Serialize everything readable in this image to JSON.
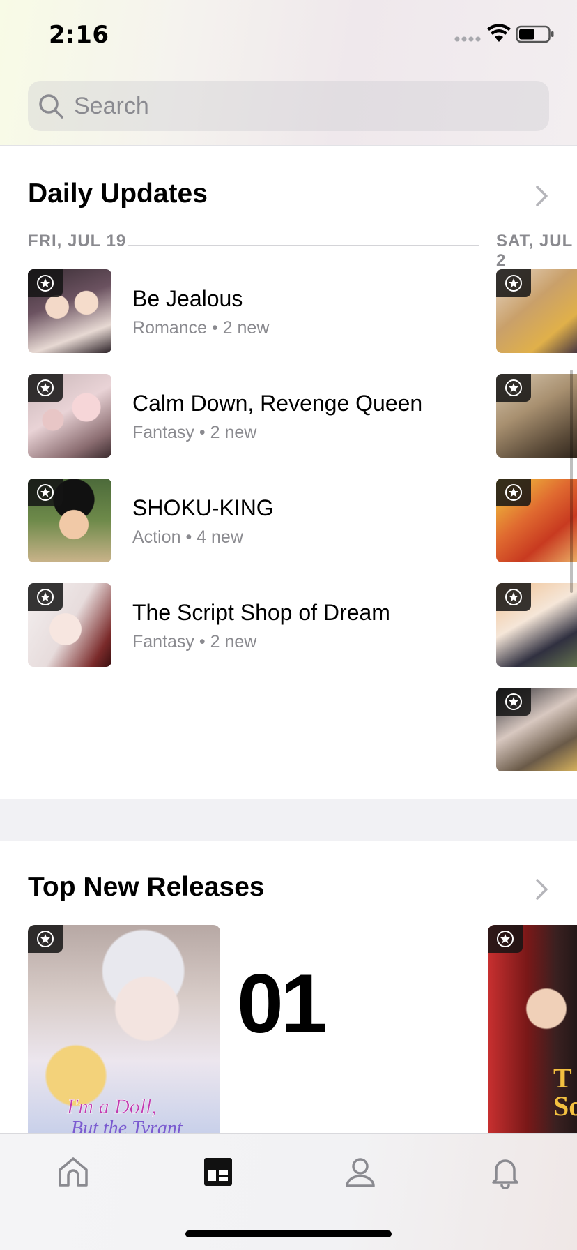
{
  "status_bar": {
    "time": "2:16"
  },
  "search": {
    "placeholder": "Search"
  },
  "daily_updates": {
    "title": "Daily Updates",
    "date_current": "FRI, JUL 19",
    "date_next": "SAT, JUL 2",
    "items": [
      {
        "title": "Be Jealous",
        "genre": "Romance",
        "count": "2 new"
      },
      {
        "title": "Calm Down, Revenge Queen",
        "genre": "Fantasy",
        "count": "2 new"
      },
      {
        "title": "SHOKU-KING",
        "genre": "Action",
        "count": "4 new"
      },
      {
        "title": "The Script Shop of Dream",
        "genre": "Fantasy",
        "count": "2 new"
      }
    ],
    "separator": "•"
  },
  "top_new_releases": {
    "title": "Top New Releases",
    "rank": "01",
    "cover_text_line1": "I'm a Doll,",
    "cover_text_line2": "But the Tyrant",
    "cover2_text": "T\nSor"
  },
  "tabs": [
    {
      "name": "home-icon"
    },
    {
      "name": "browse-icon"
    },
    {
      "name": "profile-icon"
    },
    {
      "name": "notifications-icon"
    }
  ],
  "colors": {
    "secondary_text": "#8a8a8f",
    "badge_bg": "#141414"
  }
}
